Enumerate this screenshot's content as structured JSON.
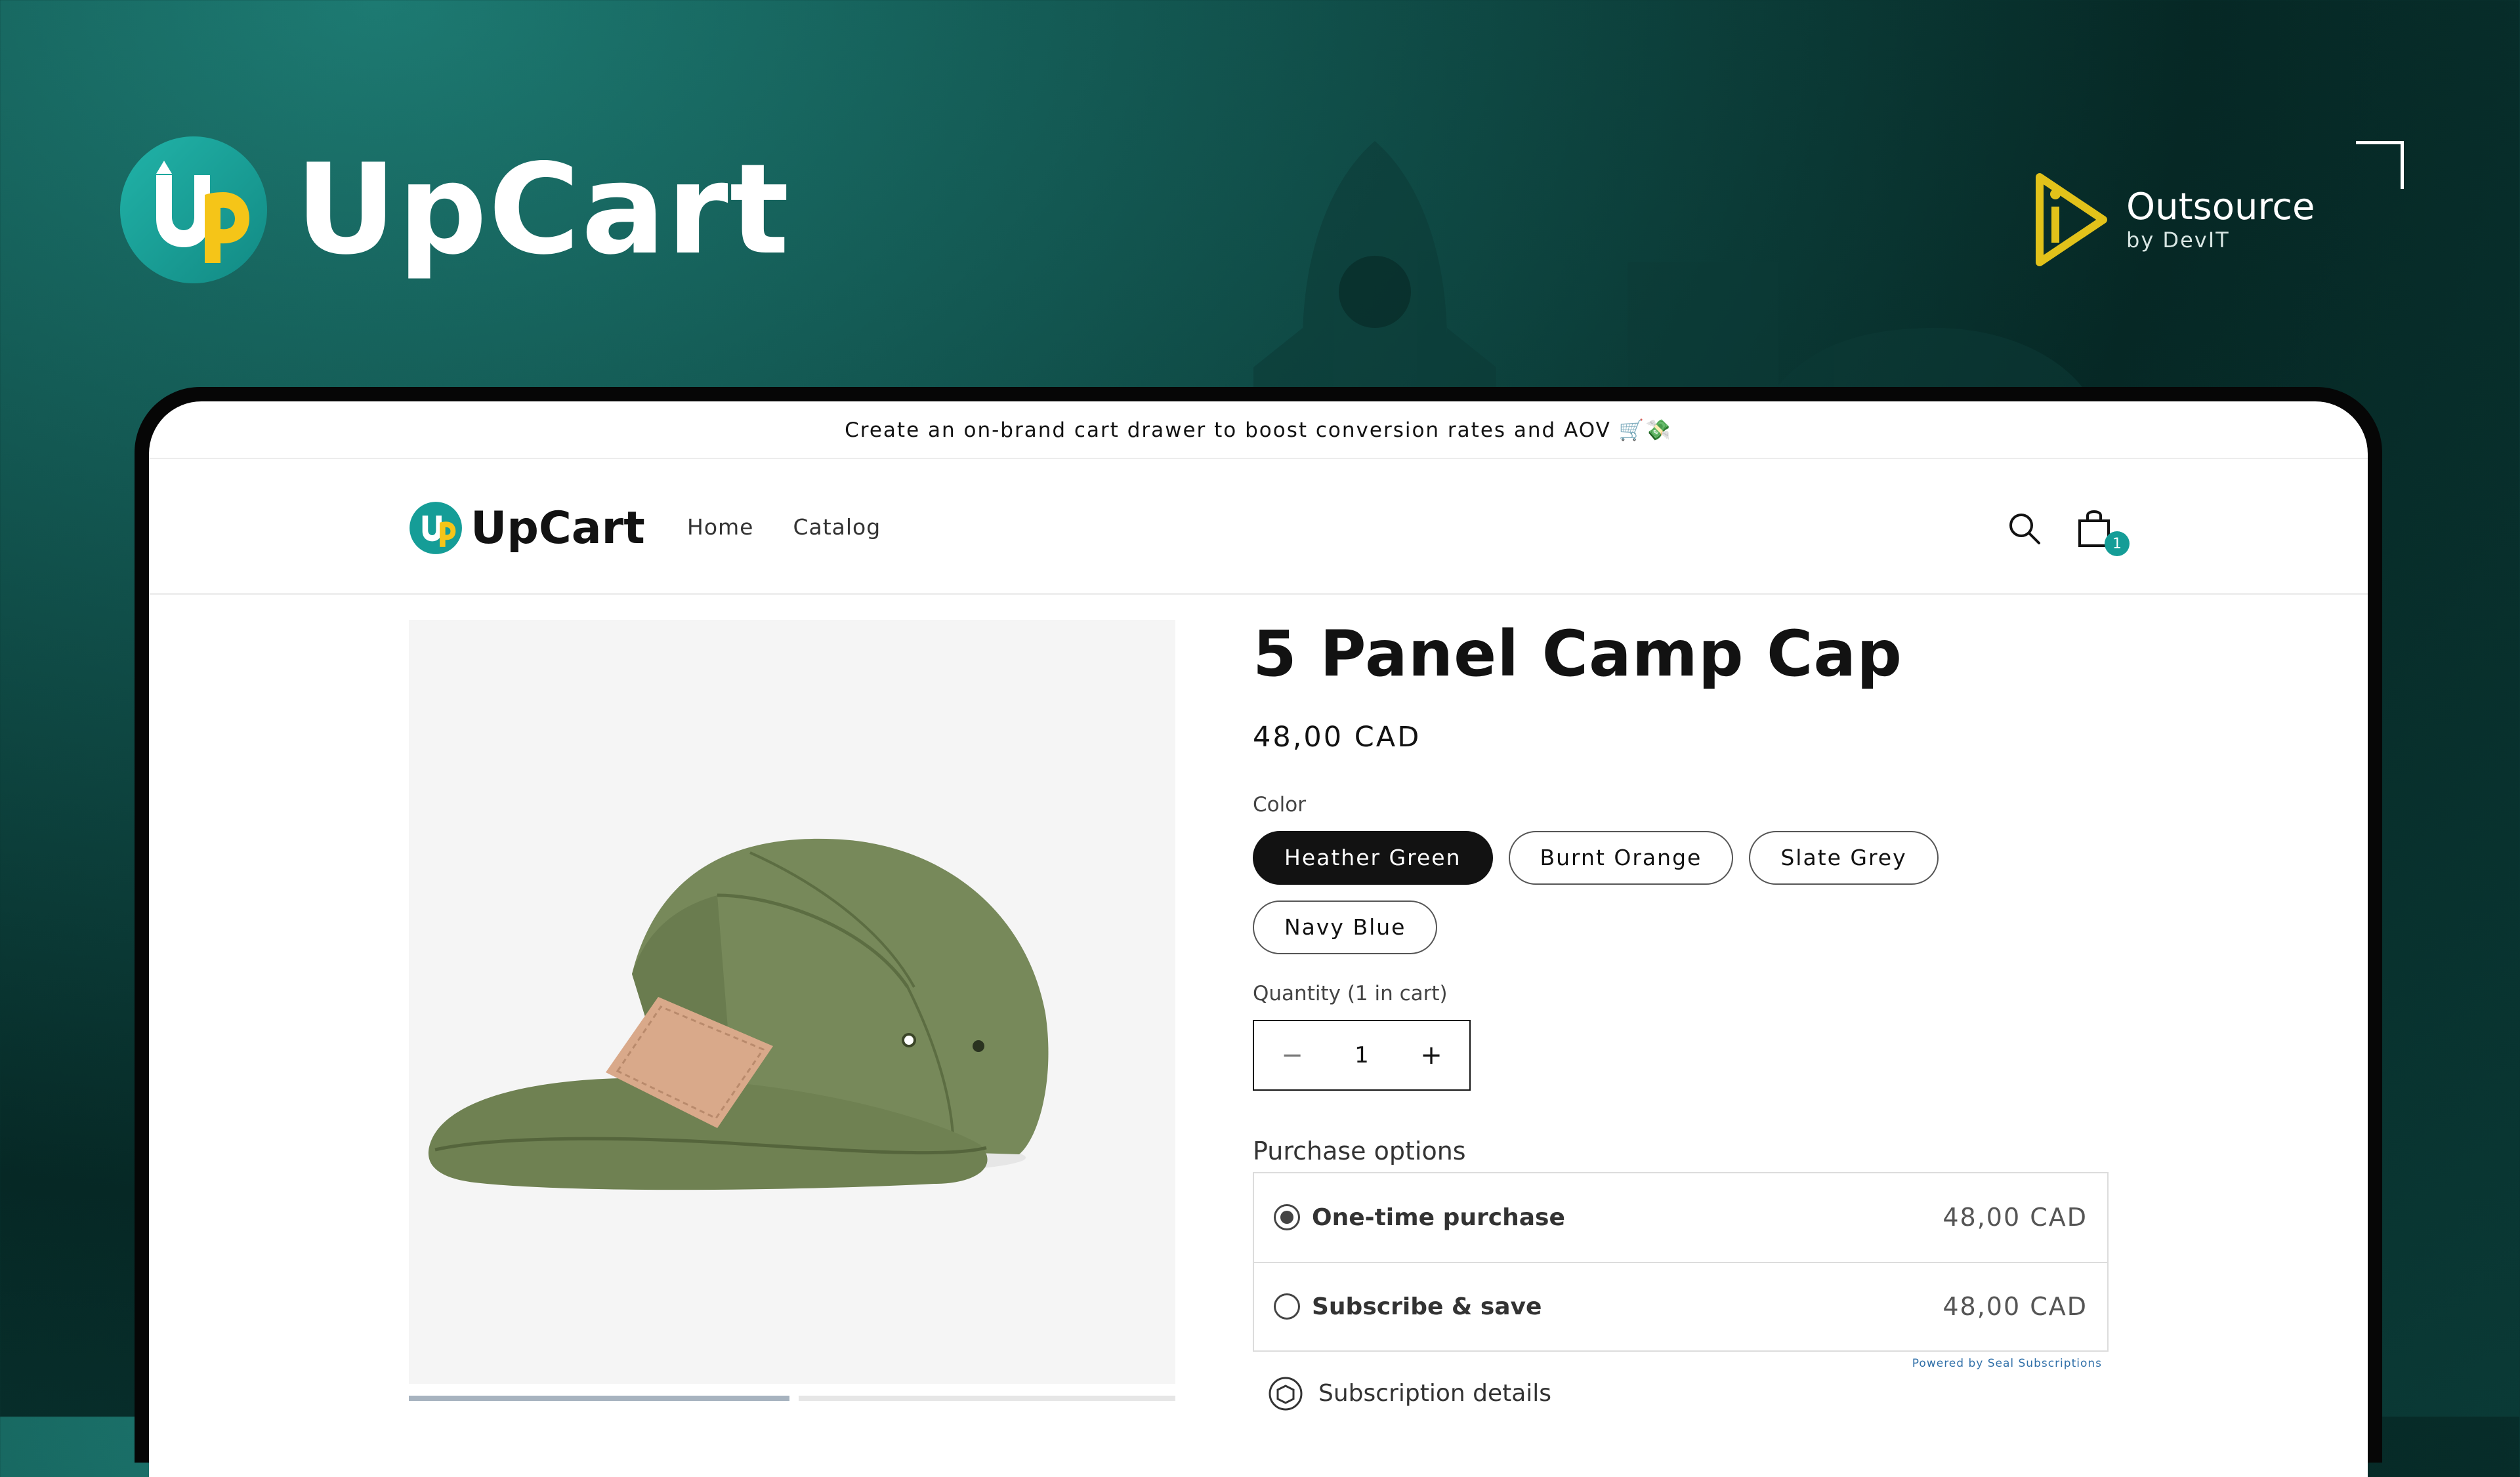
{
  "brand": {
    "name": "UpCart"
  },
  "partner": {
    "title": "Outsource",
    "subtitle": "by DevIT"
  },
  "store": {
    "announcement": "Create an on-brand cart drawer to boost conversion rates and AOV 🛒💸",
    "logo_name": "UpCart",
    "nav": [
      "Home",
      "Catalog"
    ],
    "cart_count": "1"
  },
  "product": {
    "title": "5 Panel Camp Cap",
    "price": "48,00 CAD",
    "color_label": "Color",
    "colors": [
      "Heather Green",
      "Burnt Orange",
      "Slate Grey",
      "Navy Blue"
    ],
    "selected_color": "Heather Green",
    "quantity_label": "Quantity (1 in cart)",
    "quantity": "1",
    "minus": "−",
    "plus": "+",
    "purchase_options_label": "Purchase options",
    "options": [
      {
        "name": "One-time purchase",
        "price": "48,00 CAD",
        "checked": true
      },
      {
        "name": "Subscribe & save",
        "price": "48,00 CAD",
        "checked": false
      }
    ],
    "powered_by": "Powered by Seal Subscriptions",
    "subscription_details": "Subscription details"
  },
  "colors": {
    "teal": "#159d97",
    "yellow": "#f5c518",
    "cap_green": "#7a8c5c",
    "patch": "#d9a98a"
  }
}
